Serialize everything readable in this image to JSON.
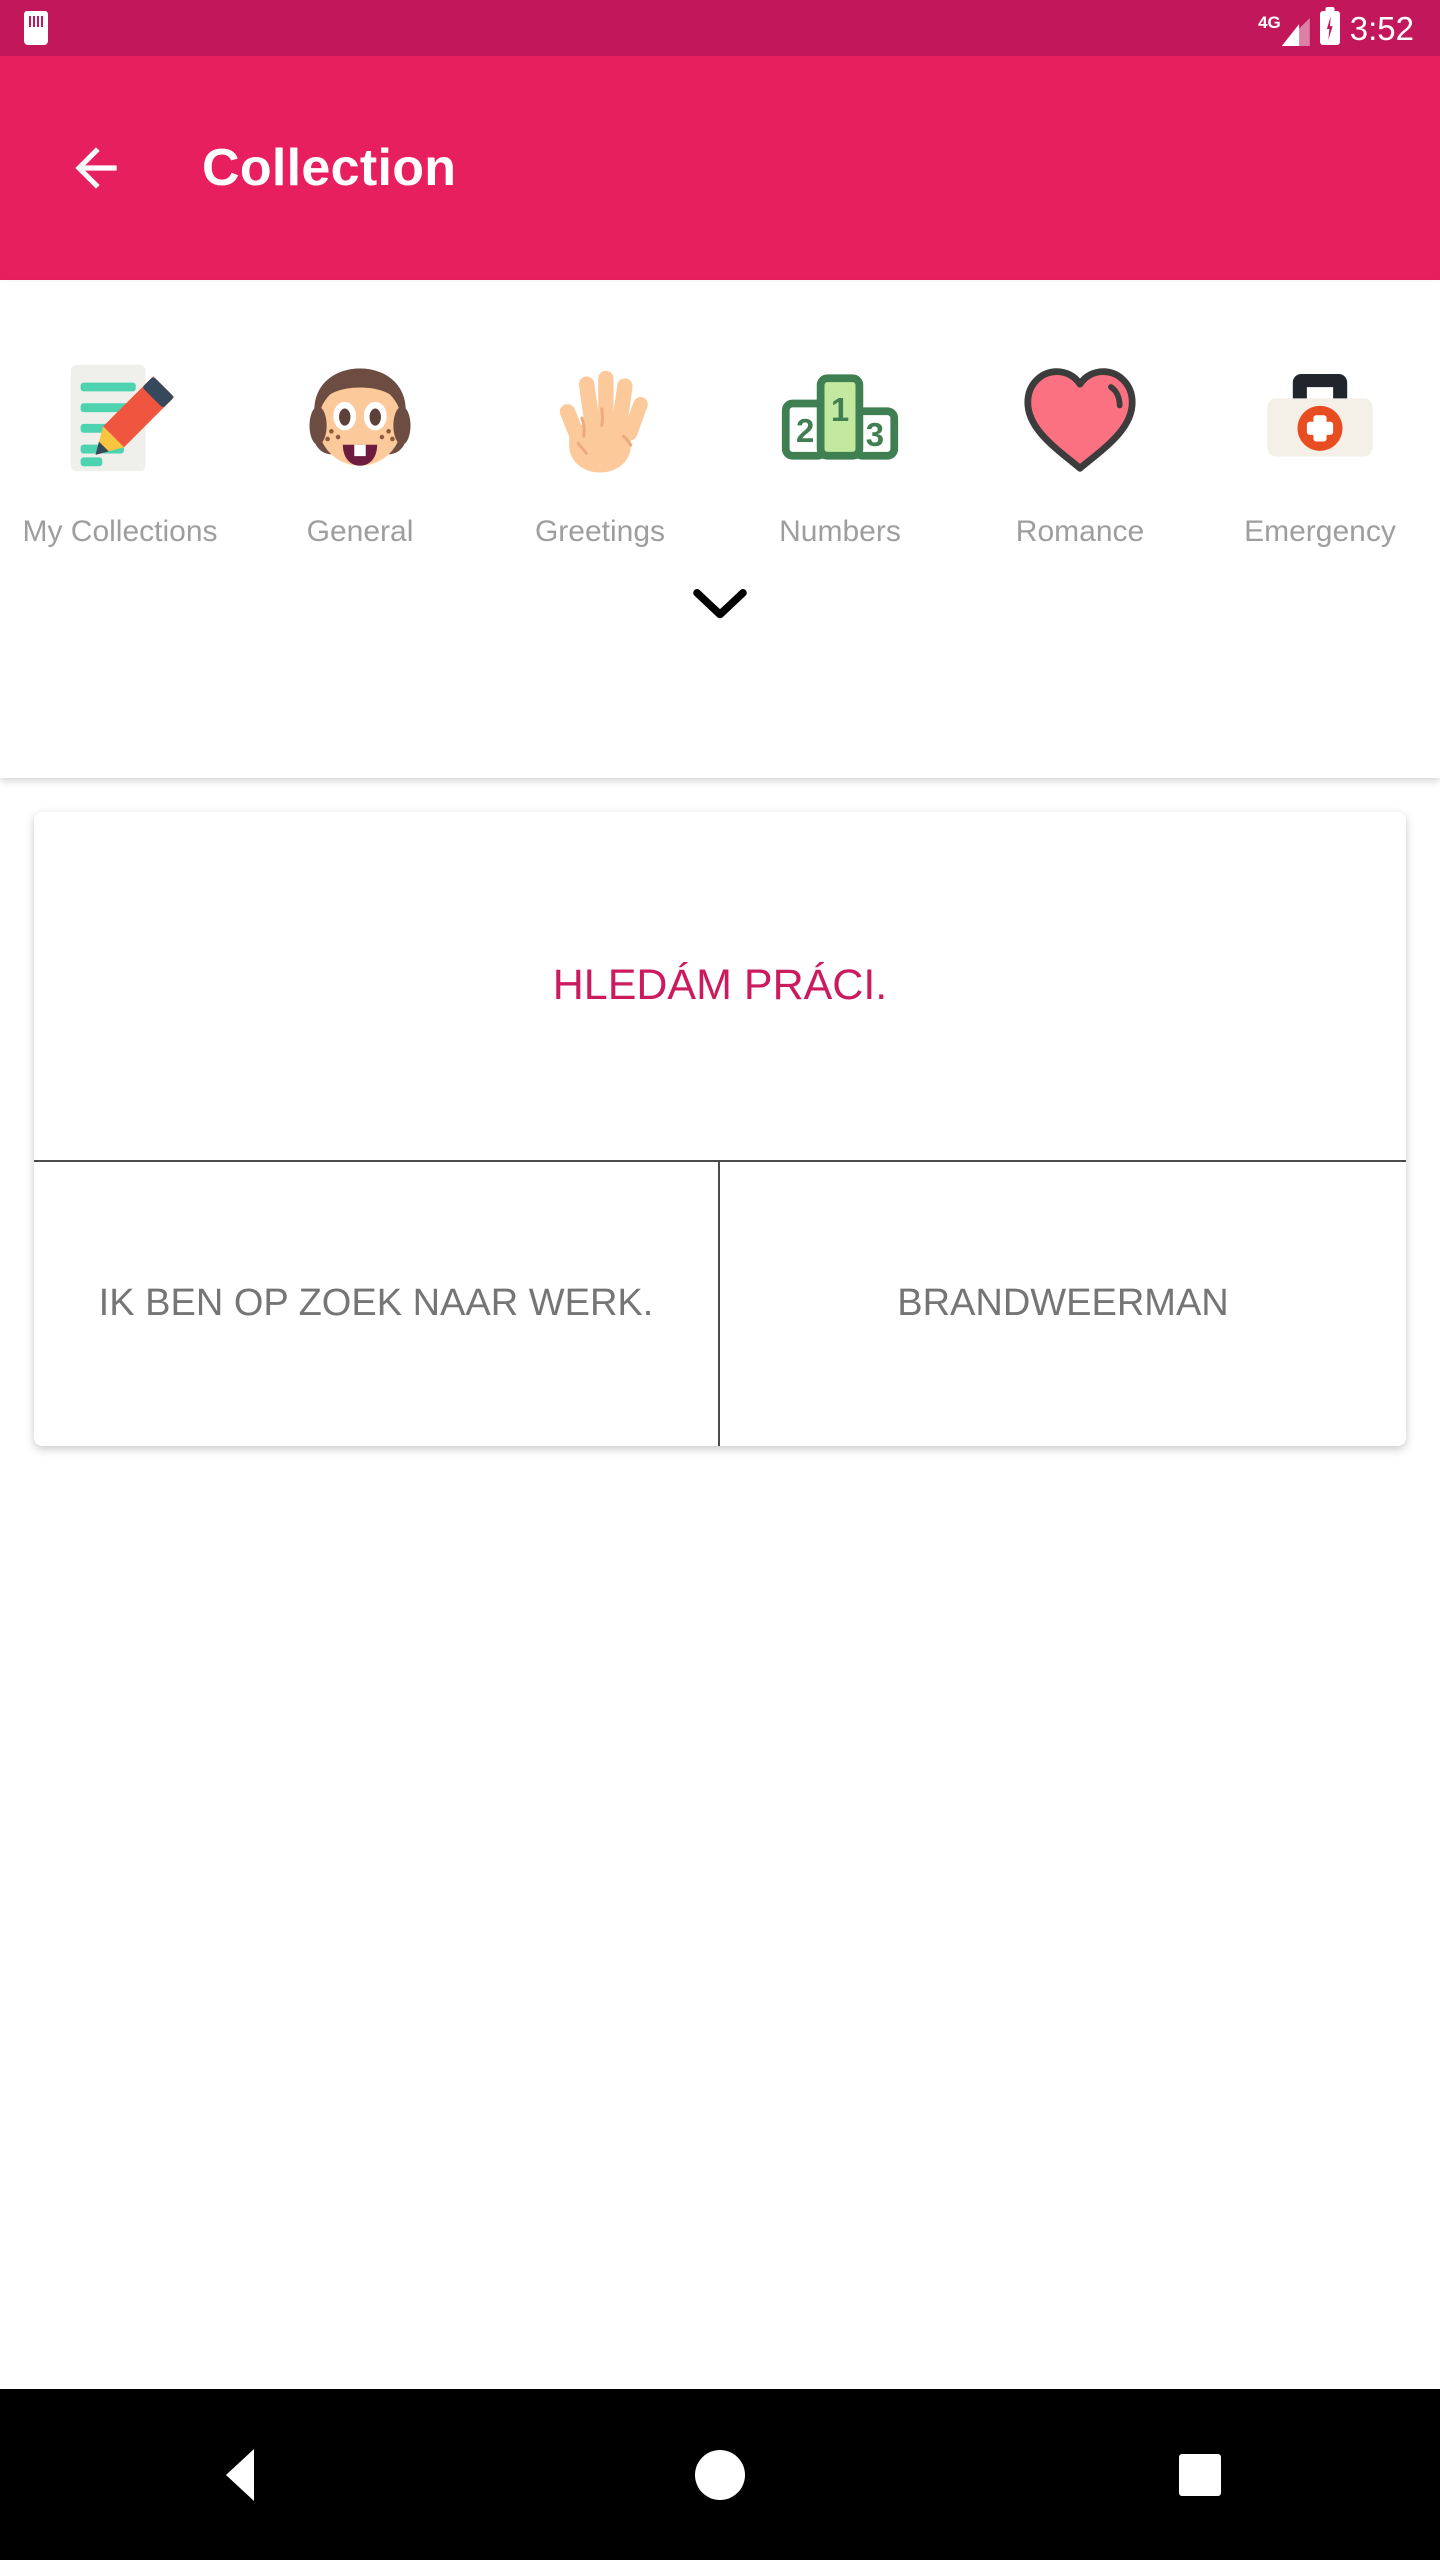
{
  "status_bar": {
    "sd_card_icon": "sd-card-icon",
    "network_label": "4G",
    "signal_icon": "signal-bars-icon",
    "battery_icon": "battery-charging-icon",
    "clock": "3:52",
    "background_color": "#C2185B"
  },
  "app_bar": {
    "back_icon": "arrow-left-icon",
    "title": "Collection",
    "background_color": "#E81F5F",
    "text_color": "#FFFFFF"
  },
  "categories": {
    "expand_icon": "chevron-down-icon",
    "label_color": "#9E9E9E",
    "items": [
      {
        "label": "My Collections",
        "icon": "memo-pencil-icon"
      },
      {
        "label": "General",
        "icon": "girl-face-icon"
      },
      {
        "label": "Greetings",
        "icon": "raised-hand-icon"
      },
      {
        "label": "Numbers",
        "icon": "podium-icon"
      },
      {
        "label": "Romance",
        "icon": "heart-icon"
      },
      {
        "label": "Emergency",
        "icon": "first-aid-kit-icon"
      }
    ]
  },
  "phrase_card": {
    "primary_text": "HLEDÁM PRÁCI.",
    "primary_color": "#CC1A5E",
    "translation_color": "#757575",
    "translations": [
      {
        "text": "IK BEN OP ZOEK NAAR WERK."
      },
      {
        "text": "BRANDWEERMAN"
      }
    ]
  },
  "navigation_bar": {
    "background_color": "#000000",
    "buttons": [
      {
        "name": "back",
        "icon": "triangle-back-icon"
      },
      {
        "name": "home",
        "icon": "circle-home-icon"
      },
      {
        "name": "recents",
        "icon": "square-recents-icon"
      }
    ]
  }
}
